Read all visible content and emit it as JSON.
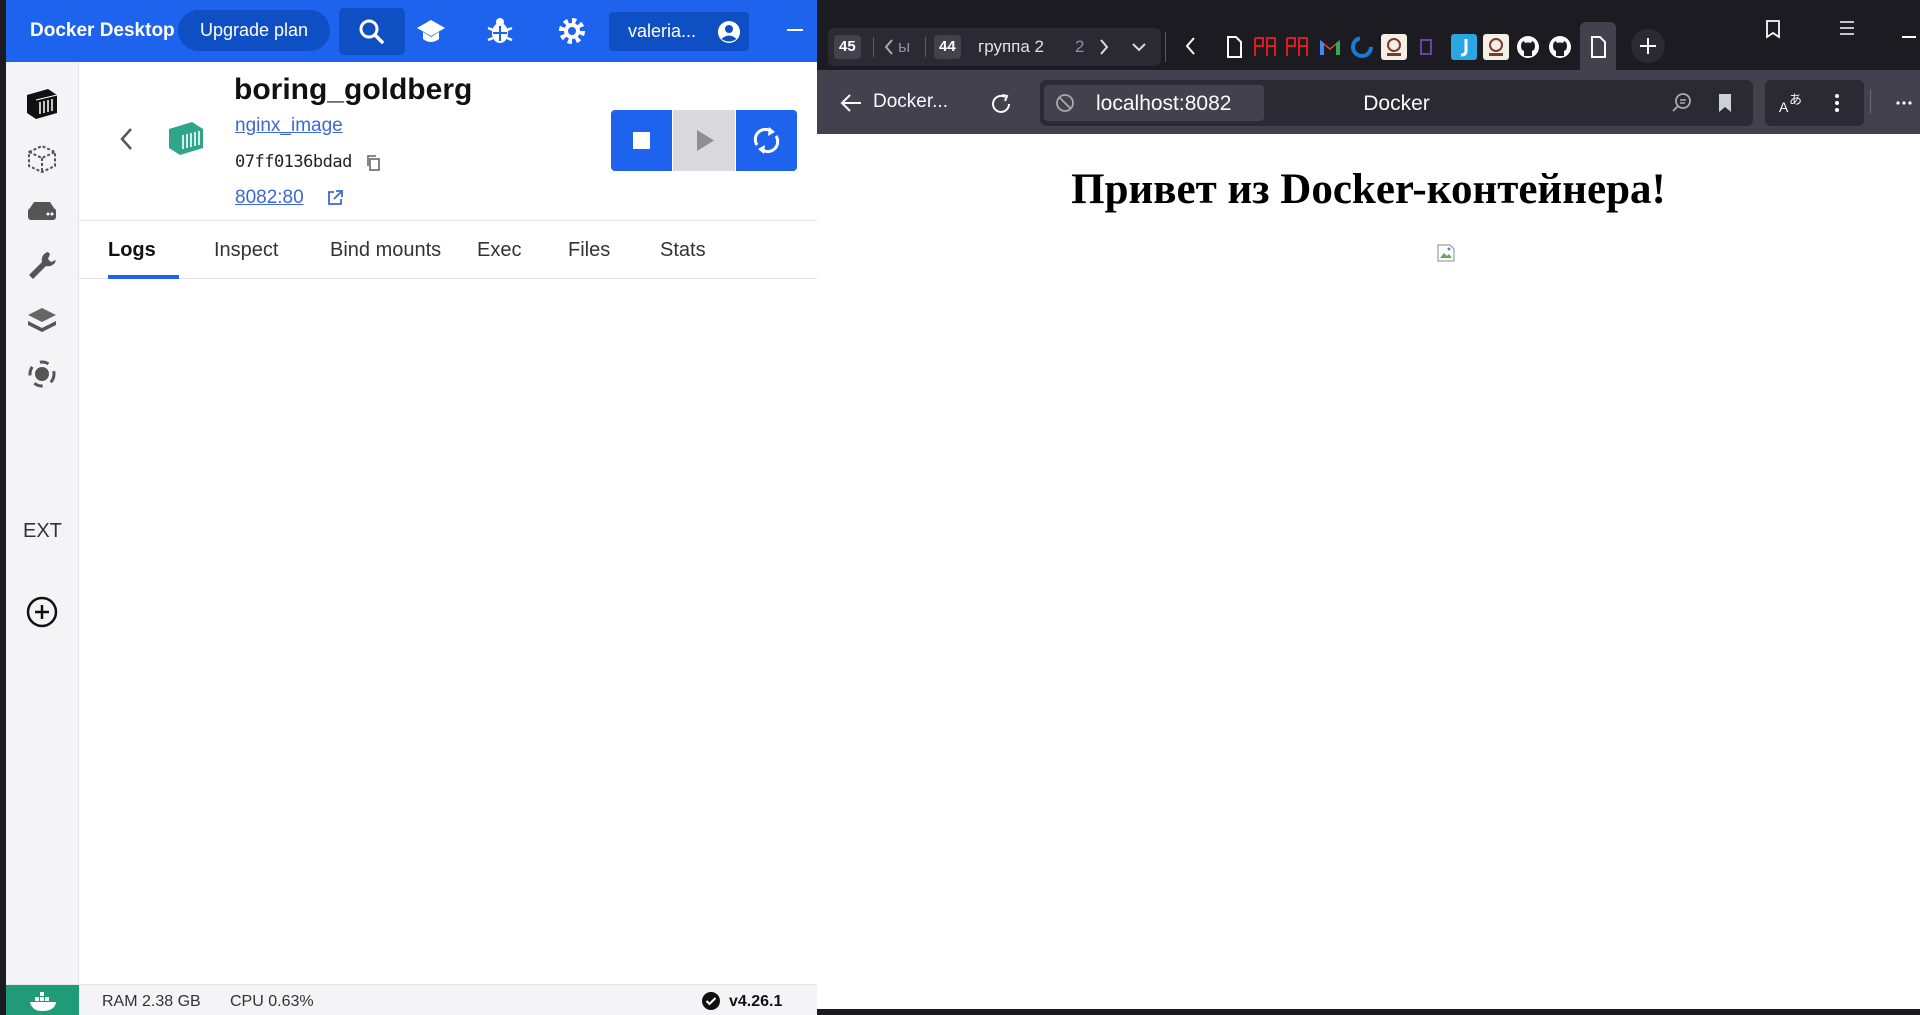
{
  "docker": {
    "app_title": "Docker Desktop",
    "upgrade_label": "Upgrade plan",
    "account_label": "valeria...",
    "nav_ext_label": "EXT",
    "container": {
      "name": "boring_goldberg",
      "image": "nginx_image",
      "id": "07ff0136bdad",
      "port": "8082:80"
    },
    "tabs": [
      "Logs",
      "Inspect",
      "Bind mounts",
      "Exec",
      "Files",
      "Stats"
    ],
    "active_tab": "Logs",
    "status": {
      "ram": "RAM 2.38 GB",
      "cpu": "CPU 0.63%",
      "version": "v4.26.1"
    },
    "colors": {
      "accent": "#1d63ed",
      "container_icon": "#2fa58b"
    }
  },
  "browser": {
    "tab_group": {
      "count_left": "45",
      "left_label": "ы",
      "count_mid": "44",
      "mid_label": "группа 2",
      "count_right": "2"
    },
    "back_label": "Docker...",
    "url": "localhost:8082",
    "page_title": "Docker",
    "page": {
      "heading": "Привет из Docker-контейнера!"
    }
  }
}
